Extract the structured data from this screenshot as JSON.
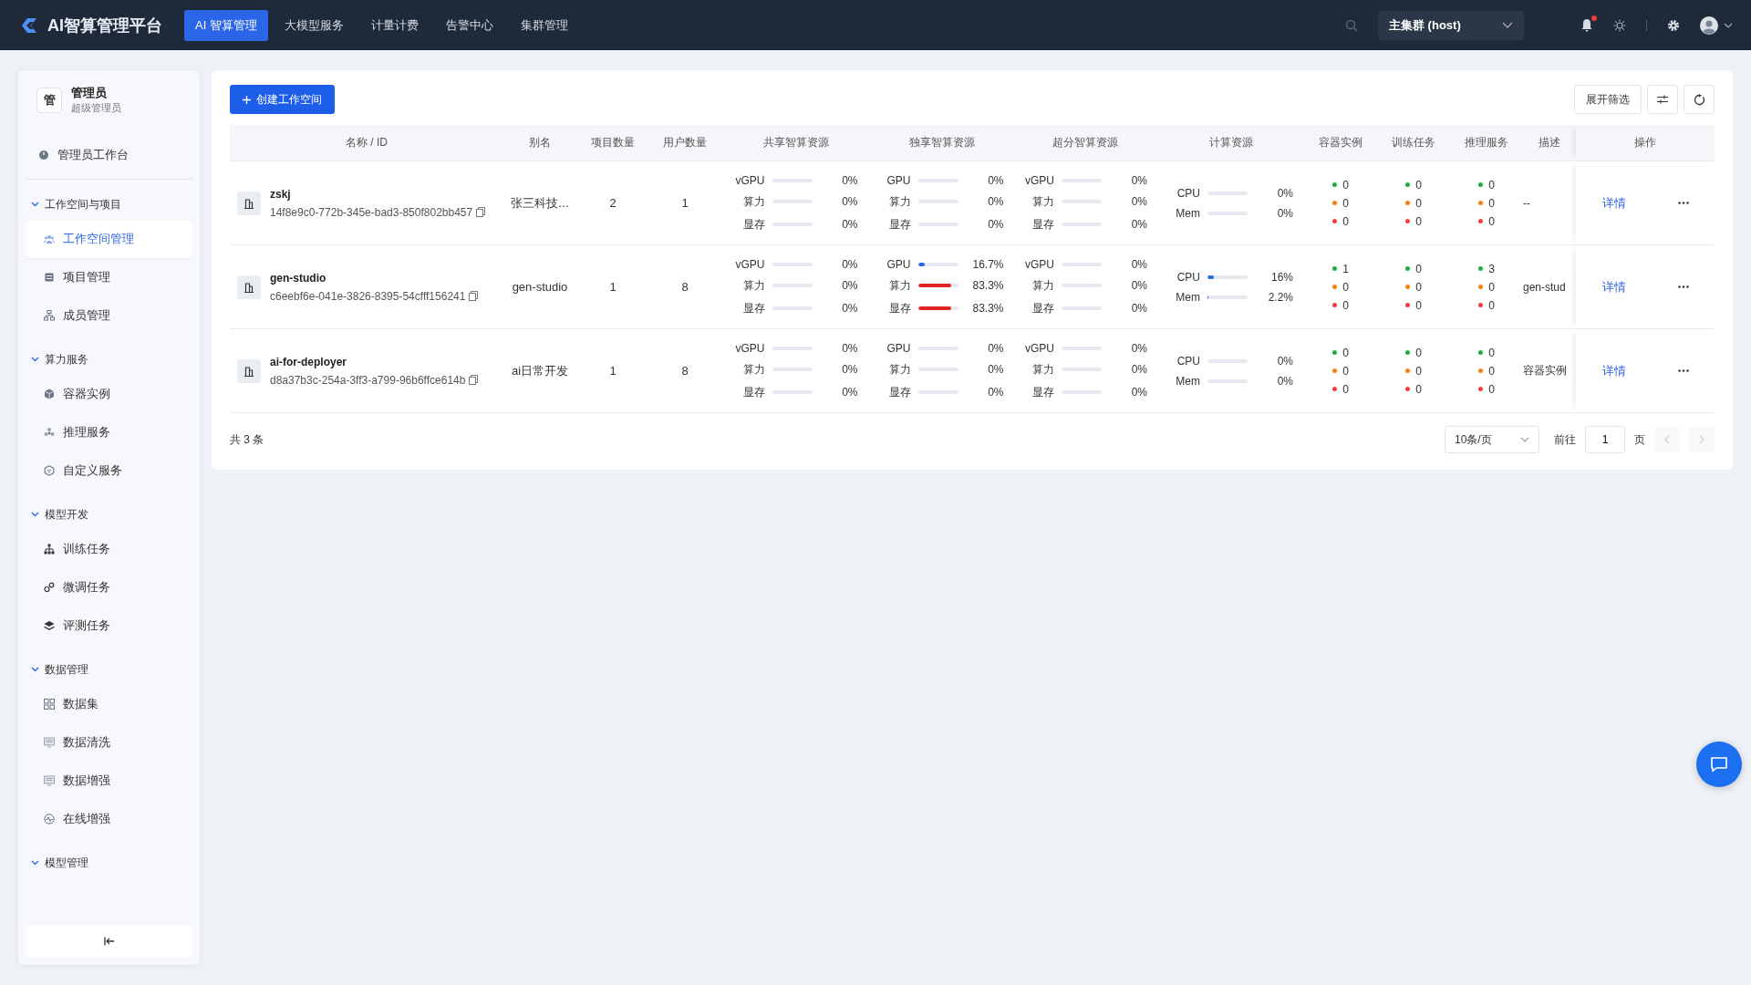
{
  "topbar": {
    "logo": "AI智算管理平台",
    "tabs": [
      {
        "label": "AI 智算管理",
        "selected": true
      },
      {
        "label": "大模型服务",
        "selected": false
      },
      {
        "label": "计量计费",
        "selected": false
      },
      {
        "label": "告警中心",
        "selected": false
      },
      {
        "label": "集群管理",
        "selected": false
      }
    ],
    "cluster": "主集群 (host)",
    "notifications": {
      "unread": true
    }
  },
  "sidebar": {
    "user": {
      "avatar": "管",
      "name": "管理员",
      "role": "超级管理员"
    },
    "items": [
      {
        "kind": "link",
        "label": "管理员工作台",
        "selected": false
      },
      {
        "kind": "group",
        "label": "工作空间与项目",
        "expanded": true,
        "children": [
          {
            "label": "工作空间管理",
            "selected": true
          },
          {
            "label": "项目管理",
            "selected": false
          },
          {
            "label": "成员管理",
            "selected": false
          }
        ]
      },
      {
        "kind": "group",
        "label": "算力服务",
        "expanded": true,
        "children": [
          {
            "label": "容器实例",
            "selected": false
          },
          {
            "label": "推理服务",
            "selected": false
          },
          {
            "label": "自定义服务",
            "selected": false
          }
        ]
      },
      {
        "kind": "group",
        "label": "模型开发",
        "expanded": true,
        "children": [
          {
            "label": "训练任务",
            "selected": false
          },
          {
            "label": "微调任务",
            "selected": false
          },
          {
            "label": "评测任务",
            "selected": false
          }
        ]
      },
      {
        "kind": "group",
        "label": "数据管理",
        "expanded": true,
        "children": [
          {
            "label": "数据集",
            "selected": false
          },
          {
            "label": "数据清洗",
            "selected": false
          },
          {
            "label": "数据增强",
            "selected": false
          },
          {
            "label": "在线增强",
            "selected": false
          }
        ]
      },
      {
        "kind": "group",
        "label": "模型管理",
        "expanded": true
      }
    ]
  },
  "toolbar": {
    "create_button": "创建工作空间",
    "filter_button": "展开筛选"
  },
  "table": {
    "columns": [
      "名称 / ID",
      "别名",
      "项目数量",
      "用户数量",
      "共享智算资源",
      "独享智算资源",
      "超分智算资源",
      "计算资源",
      "容器实例",
      "训练任务",
      "推理服务",
      "描述",
      "操作"
    ],
    "rows": [
      {
        "name": "zskj",
        "id": "14f8e9c0-772b-345e-bad3-850f802bb457",
        "alias": "张三科技…",
        "projects": "2",
        "users": "1",
        "shared": [
          {
            "label": "vGPU",
            "level": 0,
            "reading": "0%"
          },
          {
            "label": "算力",
            "level": 0,
            "reading": "0%"
          },
          {
            "label": "显存",
            "level": 0,
            "reading": "0%"
          }
        ],
        "exclusive": [
          {
            "label": "GPU",
            "level": 0,
            "reading": "0%"
          },
          {
            "label": "算力",
            "level": 0,
            "reading": "0%"
          },
          {
            "label": "显存",
            "level": 0,
            "reading": "0%"
          }
        ],
        "oversold": [
          {
            "label": "vGPU",
            "level": 0,
            "reading": "0%"
          },
          {
            "label": "算力",
            "level": 0,
            "reading": "0%"
          },
          {
            "label": "显存",
            "level": 0,
            "reading": "0%"
          }
        ],
        "compute": [
          {
            "label": "CPU",
            "level": 0,
            "reading": "0%"
          },
          {
            "label": "Mem",
            "level": 0,
            "reading": "0%"
          }
        ],
        "containers": [
          {
            "color": "#1fae3d",
            "count": "0"
          },
          {
            "color": "#f5820d",
            "count": "0"
          },
          {
            "color": "#ef3e3e",
            "count": "0"
          }
        ],
        "training": [
          {
            "color": "#1fae3d",
            "count": "0"
          },
          {
            "color": "#f5820d",
            "count": "0"
          },
          {
            "color": "#ef3e3e",
            "count": "0"
          }
        ],
        "inference": [
          {
            "color": "#1fae3d",
            "count": "0"
          },
          {
            "color": "#f5820d",
            "count": "0"
          },
          {
            "color": "#ef3e3e",
            "count": "0"
          }
        ],
        "description": "--",
        "detail": "详情"
      },
      {
        "name": "gen-studio",
        "id": "c6eebf6e-041e-3826-8395-54cfff156241",
        "alias": "gen-studio",
        "projects": "1",
        "users": "8",
        "shared": [
          {
            "label": "vGPU",
            "level": 0,
            "reading": "0%"
          },
          {
            "label": "算力",
            "level": 0,
            "reading": "0%"
          },
          {
            "label": "显存",
            "level": 0,
            "reading": "0%"
          }
        ],
        "exclusive": [
          {
            "label": "GPU",
            "level": 0.167,
            "reading": "16.7%"
          },
          {
            "label": "算力",
            "level": 0.833,
            "reading": "83.3%"
          },
          {
            "label": "显存",
            "level": 0.833,
            "reading": "83.3%"
          }
        ],
        "oversold": [
          {
            "label": "vGPU",
            "level": 0,
            "reading": "0%"
          },
          {
            "label": "算力",
            "level": 0,
            "reading": "0%"
          },
          {
            "label": "显存",
            "level": 0,
            "reading": "0%"
          }
        ],
        "compute": [
          {
            "label": "CPU",
            "level": 0.16,
            "reading": "16%"
          },
          {
            "label": "Mem",
            "level": 0.022,
            "reading": "2.2%"
          }
        ],
        "containers": [
          {
            "color": "#1fae3d",
            "count": "1"
          },
          {
            "color": "#f5820d",
            "count": "0"
          },
          {
            "color": "#ef3e3e",
            "count": "0"
          }
        ],
        "training": [
          {
            "color": "#1fae3d",
            "count": "0"
          },
          {
            "color": "#f5820d",
            "count": "0"
          },
          {
            "color": "#ef3e3e",
            "count": "0"
          }
        ],
        "inference": [
          {
            "color": "#1fae3d",
            "count": "3"
          },
          {
            "color": "#f5820d",
            "count": "0"
          },
          {
            "color": "#ef3e3e",
            "count": "0"
          }
        ],
        "description": "gen-stud",
        "detail": "详情"
      },
      {
        "name": "ai-for-deployer",
        "id": "d8a37b3c-254a-3ff3-a799-96b6ffce614b",
        "alias": "ai日常开发",
        "projects": "1",
        "users": "8",
        "shared": [
          {
            "label": "vGPU",
            "level": 0,
            "reading": "0%"
          },
          {
            "label": "算力",
            "level": 0,
            "reading": "0%"
          },
          {
            "label": "显存",
            "level": 0,
            "reading": "0%"
          }
        ],
        "exclusive": [
          {
            "label": "GPU",
            "level": 0,
            "reading": "0%"
          },
          {
            "label": "算力",
            "level": 0,
            "reading": "0%"
          },
          {
            "label": "显存",
            "level": 0,
            "reading": "0%"
          }
        ],
        "oversold": [
          {
            "label": "vGPU",
            "level": 0,
            "reading": "0%"
          },
          {
            "label": "算力",
            "level": 0,
            "reading": "0%"
          },
          {
            "label": "显存",
            "level": 0,
            "reading": "0%"
          }
        ],
        "compute": [
          {
            "label": "CPU",
            "level": 0,
            "reading": "0%"
          },
          {
            "label": "Mem",
            "level": 0,
            "reading": "0%"
          }
        ],
        "containers": [
          {
            "color": "#1fae3d",
            "count": "0"
          },
          {
            "color": "#f5820d",
            "count": "0"
          },
          {
            "color": "#ef3e3e",
            "count": "0"
          }
        ],
        "training": [
          {
            "color": "#1fae3d",
            "count": "0"
          },
          {
            "color": "#f5820d",
            "count": "0"
          },
          {
            "color": "#ef3e3e",
            "count": "0"
          }
        ],
        "inference": [
          {
            "color": "#1fae3d",
            "count": "0"
          },
          {
            "color": "#f5820d",
            "count": "0"
          },
          {
            "color": "#ef3e3e",
            "count": "0"
          }
        ],
        "description": "容器实例",
        "detail": "详情"
      }
    ]
  },
  "pagination": {
    "total": "共 3 条",
    "page_size": "10条/页",
    "goto": "前往",
    "page": "1",
    "page_unit": "页",
    "prev": {
      "disabled": true
    },
    "next": {
      "disabled": true
    }
  }
}
